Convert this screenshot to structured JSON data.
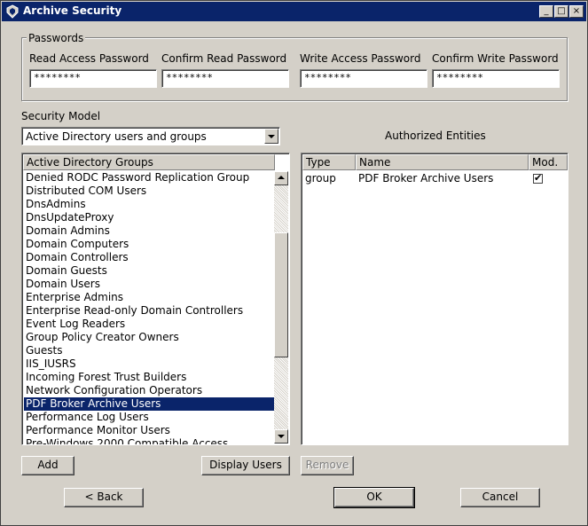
{
  "window": {
    "title": "Archive Security",
    "buttons": {
      "minimize": "_",
      "maximize": "□",
      "close": "×"
    }
  },
  "passwords": {
    "group_title": "Passwords",
    "fields": [
      {
        "label": "Read Access Password",
        "value": "********"
      },
      {
        "label": "Confirm Read Password",
        "value": "********"
      },
      {
        "label": "Write Access Password",
        "value": "********"
      },
      {
        "label": "Confirm Write Password",
        "value": "********"
      }
    ]
  },
  "security_model": {
    "label": "Security Model",
    "selected": "Active Directory users and groups"
  },
  "authorized_title": "Authorized Entities",
  "groups_list": {
    "header": "Active Directory Groups",
    "items": [
      "Denied RODC Password Replication Group",
      "Distributed COM Users",
      "DnsAdmins",
      "DnsUpdateProxy",
      "Domain Admins",
      "Domain Computers",
      "Domain Controllers",
      "Domain Guests",
      "Domain Users",
      "Enterprise Admins",
      "Enterprise Read-only Domain Controllers",
      "Event Log Readers",
      "Group Policy Creator Owners",
      "Guests",
      "IIS_IUSRS",
      "Incoming Forest Trust Builders",
      "Network Configuration Operators",
      "PDF Broker Archive Users",
      "Performance Log Users",
      "Performance Monitor Users",
      "Pre-Windows 2000 Compatible Access"
    ],
    "selected": "PDF Broker Archive Users"
  },
  "entities_table": {
    "columns": [
      "Type",
      "Name",
      "Mod."
    ],
    "rows": [
      {
        "type": "group",
        "name": "PDF Broker Archive Users",
        "mod": true
      }
    ]
  },
  "buttons": {
    "add": "Add",
    "display_users": "Display Users",
    "remove": "Remove",
    "back": "< Back",
    "ok": "OK",
    "cancel": "Cancel"
  },
  "colors": {
    "title_bar": "#0a246a",
    "selection": "#0a246a",
    "face": "#d4d0c8"
  }
}
